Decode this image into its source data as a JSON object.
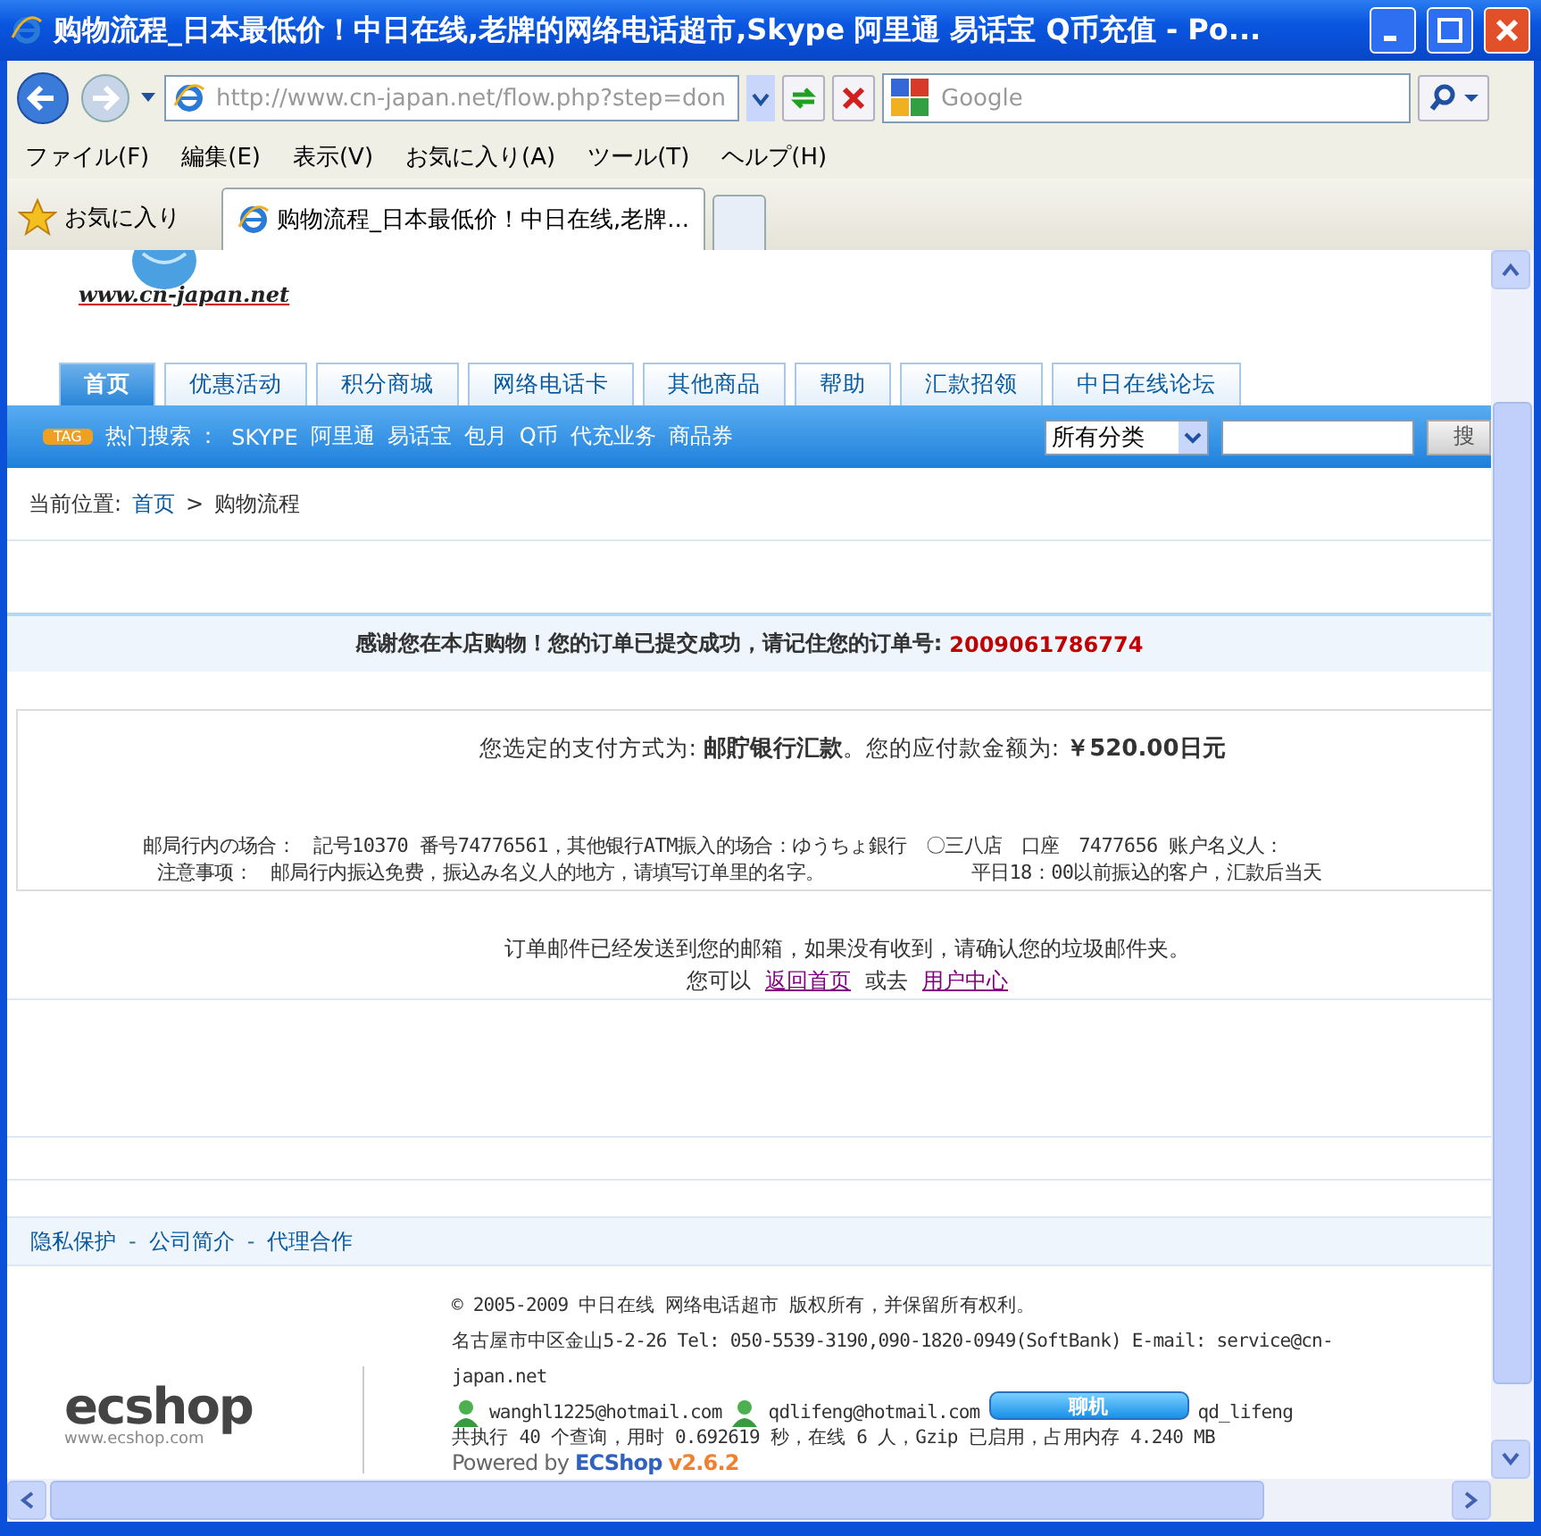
{
  "window": {
    "title": "购物流程_日本最低价！中日在线,老牌的网络电话超市,Skype 阿里通 易话宝 Q币充值 - Po..."
  },
  "toolbar": {
    "address": "http://www.cn-japan.net/flow.php?step=don",
    "search_placeholder": "Google"
  },
  "menu": [
    "ファイル(F)",
    "編集(E)",
    "表示(V)",
    "お気に入り(A)",
    "ツール(T)",
    "ヘルプ(H)"
  ],
  "favorites": "お気に入り",
  "tabs": [
    {
      "label": "购物流程_日本最低价！中日在线,老牌...",
      "selected": true
    }
  ],
  "page": {
    "logo_url": "www.cn-japan.net",
    "nav": [
      {
        "label": "首页",
        "selected": true
      },
      {
        "label": "优惠活动",
        "selected": false
      },
      {
        "label": "积分商城",
        "selected": false
      },
      {
        "label": "网络电话卡",
        "selected": false
      },
      {
        "label": "其他商品",
        "selected": false
      },
      {
        "label": "帮助",
        "selected": false
      },
      {
        "label": "汇款招领",
        "selected": false
      },
      {
        "label": "中日在线论坛",
        "selected": false
      }
    ],
    "hot_search": {
      "tag": "TAG",
      "label": "热门搜索 ：",
      "keywords": [
        "SKYPE",
        "阿里通",
        "易话宝",
        "包月",
        "Q币",
        "代充业务",
        "商品券"
      ]
    },
    "category_select": "所有分类",
    "search_button": "搜",
    "breadcrumb": {
      "label": "当前位置:",
      "link": "首页",
      "separator": ">",
      "current": "购物流程"
    },
    "thanks": {
      "text": "感谢您在本店购物！您的订单已提交成功，请记住您的订单号:",
      "order_no": "2009061786774"
    },
    "payment": {
      "summary": "您选定的支付方式为: **邮貯银行汇款**。您的应付款金额为: **￥520.00日元**",
      "lines": [
        [
          "邮局行内の场合：",
          "記号10370 番号74776561，其他银行ATM振入的场合：ゆうちょ銀行　〇三八店　口座　7477656 账户名义人："
        ],
        [
          "注意事项：",
          "邮局行内振込免费，振込み名义人的地方，请填写订单里的名字。",
          "平日18：00以前振込的客户，汇款后当天"
        ]
      ]
    },
    "mail_notice": "订单邮件已经发送到您的邮箱，如果没有收到，请确认您的垃圾邮件夹。",
    "next": {
      "prefix": "您可以",
      "link1": "返回首页",
      "middle": "或去",
      "link2": "用户中心"
    },
    "footer_links": [
      {
        "kind": "link",
        "text": "隐私保护"
      },
      {
        "kind": "sep",
        "text": "-"
      },
      {
        "kind": "link",
        "text": "公司简介"
      },
      {
        "kind": "sep",
        "text": "-"
      },
      {
        "kind": "link",
        "text": "代理合作"
      }
    ],
    "footer": {
      "logo": "ecshop",
      "logo_url": "www.ecshop.com",
      "copyright": "© 2005-2009 中日在线 网络电话超市 版权所有，并保留所有权利。",
      "address_lines": [
        "名古屋市中区金山5-2-26 Tel: 050-5539-3190,090-1820-0949(SoftBank) E-mail: service@cn-",
        "japan.net"
      ],
      "contacts": [
        "wanghl1225@hotmail.com",
        "qdlifeng@hotmail.com"
      ],
      "chat_button": "聊机",
      "chat_name": "qd_lifeng",
      "stats": "共执行 40 个查询，用时 0.692619 秒，在线 6 人，Gzip 已启用，占用内存 4.240 MB",
      "powered": "Powered by",
      "powered_brand": "ECShop",
      "powered_version": "v2.6.2"
    }
  }
}
